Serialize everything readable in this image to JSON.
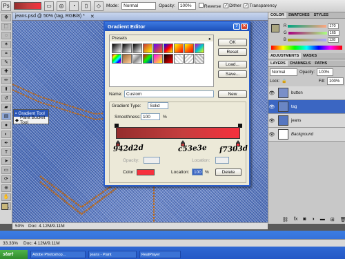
{
  "options": {
    "mode_label": "Mode:",
    "mode_value": "Normal",
    "opacity_label": "Opacity:",
    "opacity_value": "100%",
    "reverse": "Reverse",
    "dither": "Dither",
    "transparency": "Transparency"
  },
  "document": {
    "tab_title": "jeans.psd @ 50% (tag, RGB/8) *",
    "zoom": "50%",
    "doc_info": "Doc: 4.12M/9.11M"
  },
  "flyout": {
    "item1": "Gradient Tool",
    "item2": "Paint Bucket Tool",
    "shortcut": "G"
  },
  "dialog": {
    "title": "Gradient Editor",
    "presets_label": "Presets",
    "ok": "OK",
    "reset": "Reset",
    "load": "Load...",
    "save": "Save...",
    "name_label": "Name:",
    "name_value": "Custom",
    "new": "New",
    "type_label": "Gradient Type:",
    "type_value": "Solid",
    "smooth_label": "Smoothness:",
    "smooth_value": "100",
    "pct": "%",
    "stops_label": "Stops",
    "opacity_label": "Opacity:",
    "location_label": "Location:",
    "delete_label": "Delete",
    "color_label": "Color:",
    "location_value": "100",
    "gradient_colors": [
      "#942d2d",
      "#c53e3e",
      "#f7303d"
    ],
    "color_stops": [
      0.0,
      0.54,
      1.0
    ]
  },
  "annotations": {
    "stop1": "942d2d",
    "stop2": "c53e3e",
    "stop3": "f7303d"
  },
  "right_panel": {
    "color_tabs": [
      "COLOR",
      "SWATCHES",
      "STYLES"
    ],
    "r_label": "R",
    "g_label": "G",
    "b_label": "B",
    "r_value": "170",
    "g_value": "165",
    "b_value": "128",
    "adj_tabs": [
      "ADJUSTMENTS",
      "MASKS"
    ],
    "layer_tabs": [
      "LAYERS",
      "CHANNELS",
      "PATHS"
    ],
    "blend_mode": "Normal",
    "opacity_label": "Opacity:",
    "opacity_value": "100%",
    "lock_label": "Lock:",
    "fill_label": "Fill:",
    "fill_value": "100%",
    "layers": [
      "button",
      "tag",
      "jeans",
      "Background"
    ]
  },
  "status": {
    "zoom": "33.33%",
    "doc_info": "Doc: 4.12M/9.11M"
  },
  "taskbar": {
    "start": "start",
    "tasks": [
      "Adobe Photoshop...",
      "jeans - Paint",
      "RealPlayer"
    ]
  }
}
